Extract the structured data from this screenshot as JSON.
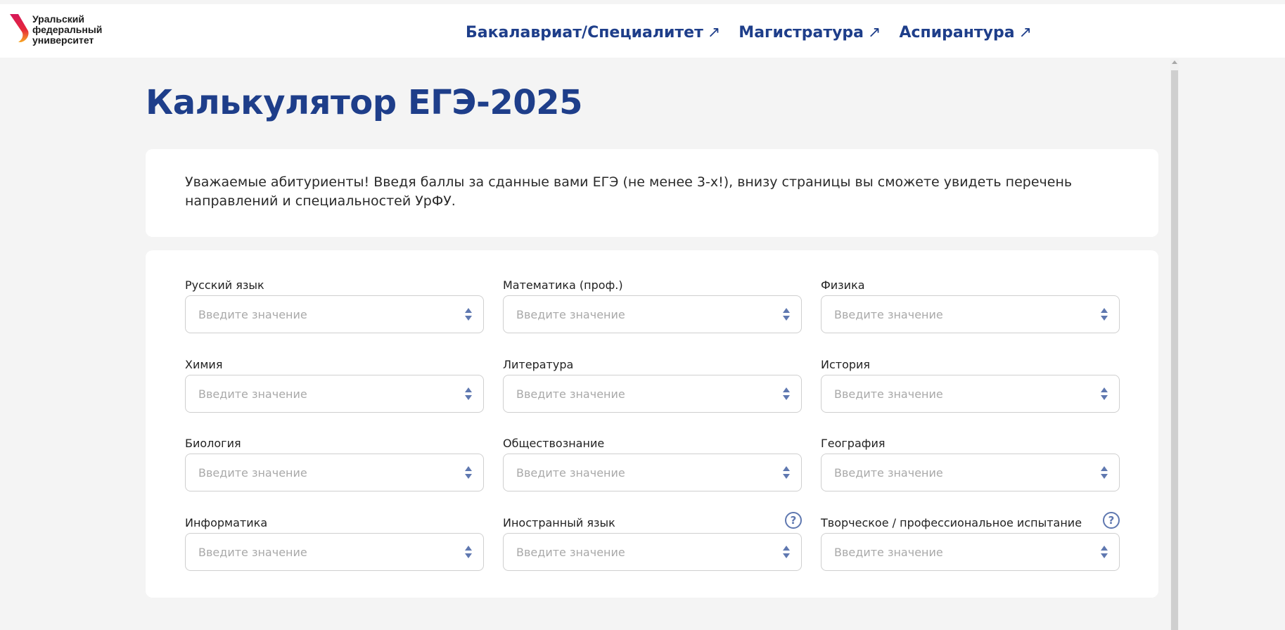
{
  "header": {
    "logo_lines": [
      "Уральский",
      "федеральный",
      "университет"
    ],
    "nav": [
      {
        "label": "Бакалавриат/Специалитет",
        "arrow": "↗"
      },
      {
        "label": "Магистратура",
        "arrow": "↗"
      },
      {
        "label": "Аспирантура",
        "arrow": "↗"
      }
    ]
  },
  "page": {
    "title": "Калькулятор ЕГЭ-2025",
    "intro": "Уважаемые абитуриенты! Введя баллы за сданные вами ЕГЭ (не менее 3-х!), внизу страницы вы сможете увидеть перечень направлений и специальностей УрФУ."
  },
  "form": {
    "placeholder": "Введите значение",
    "help_symbol": "?",
    "fields": [
      {
        "label": "Русский язык"
      },
      {
        "label": "Математика (проф.)"
      },
      {
        "label": "Физика"
      },
      {
        "label": "Химия"
      },
      {
        "label": "Литература"
      },
      {
        "label": "История"
      },
      {
        "label": "Биология"
      },
      {
        "label": "Обществознание"
      },
      {
        "label": "География"
      },
      {
        "label": "Информатика"
      },
      {
        "label": "Иностранный язык",
        "help": true
      },
      {
        "label": "Творческое / профессиональное испытание",
        "help": true
      }
    ]
  },
  "colors": {
    "brand_blue": "#1e3e8a",
    "accent_icon": "#5f78b0",
    "logo_red": "#e5273a",
    "logo_orange": "#f7a823"
  },
  "icons": {
    "logo": "urfu-logo-icon",
    "nav_arrow": "external-arrow-icon",
    "stepper": "spin-stepper-icon",
    "help": "question-circle-icon"
  }
}
